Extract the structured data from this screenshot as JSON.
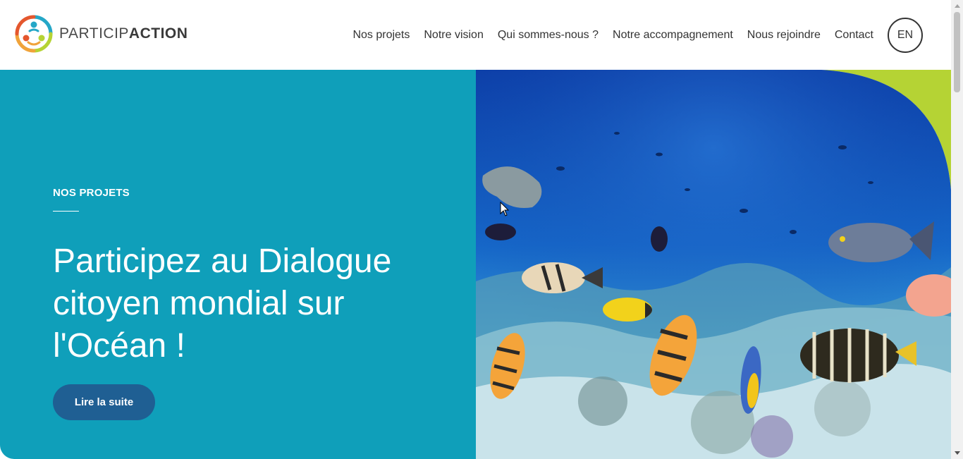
{
  "logo": {
    "text_light": "PARTICIP",
    "text_bold": "ACTION",
    "mark_icon": "participaction-people-circle-icon"
  },
  "nav": {
    "items": [
      {
        "label": "Nos projets"
      },
      {
        "label": "Notre vision"
      },
      {
        "label": "Qui sommes-nous ?"
      },
      {
        "label": "Notre accompagnement"
      },
      {
        "label": "Nous rejoindre"
      },
      {
        "label": "Contact"
      }
    ],
    "language_toggle": "EN"
  },
  "hero": {
    "eyebrow": "NOS PROJETS",
    "title": "Participez au Dialogue citoyen mondial sur l'Océan !",
    "cta_label": "Lire la suite",
    "image_subject": "coral-reef-fish-photo"
  },
  "colors": {
    "hero_background": "#0f9fba",
    "cta_background": "#1f5f93",
    "accent_green": "#b5d334",
    "text_dark": "#333333"
  }
}
